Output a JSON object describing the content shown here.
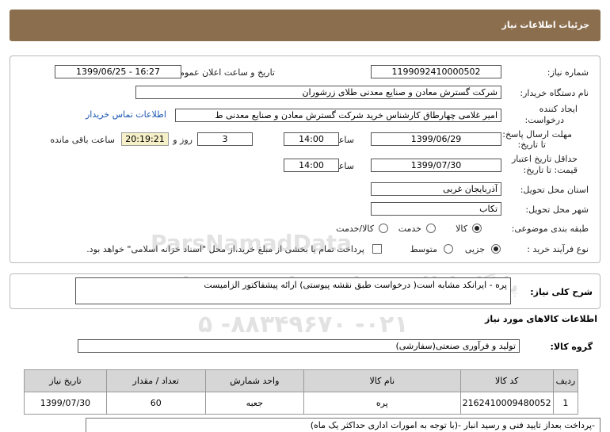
{
  "header": {
    "title": "جزئیات اطلاعات نیاز"
  },
  "form": {
    "need_number_label": "شماره نیاز:",
    "need_number": "1199092410000502",
    "announce_label": "تاریخ و ساعت اعلان عمومی:",
    "announce_value": "1399/06/25 - 16:27",
    "buyer_label": "نام دستگاه خریدار:",
    "buyer_value": "شرکت گسترش معادن و صنایع معدنی طلای زرشوران",
    "creator_label_1": "ایجاد کننده",
    "creator_label_2": "درخواست:",
    "creator_value": "امیر  غلامی چهارطاق کارشناس خرید شرکت گسترش معادن و صنایع معدنی ط",
    "contact_link": "اطلاعات تماس خریدار",
    "deadline_label_1": "مهلت ارسال پاسخ:",
    "deadline_label_2": "تا تاریخ:",
    "deadline_date": "1399/06/29",
    "time_label": "ساعت",
    "deadline_time": "14:00",
    "days_value": "3",
    "days_label": "روز و",
    "remaining_time": "20:19:21",
    "remaining_label": "ساعت باقی مانده",
    "validity_label_1": "حداقل تاریخ اعتبار",
    "validity_label_2": "قیمت: تا تاریخ:",
    "validity_date": "1399/07/30",
    "validity_time_label": "ساعت",
    "validity_time": "14:00",
    "province_label": "استان محل تحویل:",
    "province_value": "آذربایجان غربی",
    "city_label": "شهر محل تحویل:",
    "city_value": "تکاب",
    "category_label": "طبقه بندی موضوعی:",
    "category_options": [
      "کالا",
      "خدمت",
      "کالا/خدمت"
    ],
    "process_label": "نوع فرآیند خرید :",
    "process_options": [
      "جزیی",
      "متوسط"
    ],
    "payment_text": "پرداخت تمام یا بخشی از مبلغ خرید،از محل \"اسناد خزانه اسلامی\" خواهد بود."
  },
  "watermark": {
    "line1": "ParsNamadData",
    "line2": "پایگاه اطلاع رسانی مناقصه و مزایده",
    "line3": "۰۲۱- ۸۸۳۴۹۶۷۰- ۵"
  },
  "description": {
    "label": "شرح کلی نیاز:",
    "value": "پره - ایرانکد مشابه است( درخواست طبق نقشه پیوستی) ارائه پیشفاکتور الزامیست"
  },
  "goods": {
    "section_title": "اطلاعات کالاهای مورد نیاز",
    "group_label": "گروه کالا:",
    "group_value": "تولید و فرآوری صنعتی(سفارشی)",
    "columns": [
      "ردیف",
      "کد کالا",
      "نام کالا",
      "واحد شمارش",
      "تعداد / مقدار",
      "تاریخ نیاز"
    ],
    "rows": [
      [
        "1",
        "2162410009480052",
        "پره",
        "جعبه",
        "60",
        "1399/07/30"
      ]
    ]
  },
  "note": "-پرداخت بعداز تایید فنی و رسید انبار -(با توجه به امورات اداری حداکثر یک ماه)"
}
